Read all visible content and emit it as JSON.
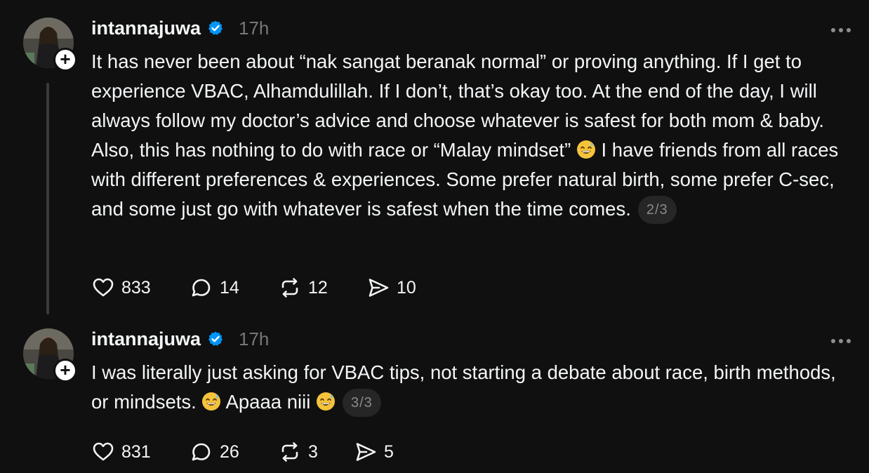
{
  "posts": [
    {
      "username": "intannajuwa",
      "timestamp": "17h",
      "text_before_emoji": "It has never been about “nak sangat beranak normal” or proving anything. If I get to experience VBAC, Alhamdulillah. If I don’t, that’s okay too. At the end of the day, I will always follow my doctor’s advice and choose whatever is safest for both mom & baby. Also, this has nothing to do with race or “Malay mindset” ",
      "text_after_emoji": " I have friends from all races with different preferences & experiences. Some prefer natural birth, some prefer C-sec, and some just go with whatever is safest when the time comes.",
      "emoji": "grinning-sweat-emoji",
      "thread_counter": "2/3",
      "likes": "833",
      "replies": "14",
      "reposts": "12",
      "shares": "10"
    },
    {
      "username": "intannajuwa",
      "timestamp": "17h",
      "text_part1": "I was literally just asking for VBAC tips, not starting a debate about race, birth methods, or mindsets. ",
      "text_part2": " Apaaa niii ",
      "emoji": "grinning-sweat-emoji",
      "thread_counter": "3/3",
      "likes": "831",
      "replies": "26",
      "reposts": "3",
      "shares": "5"
    }
  ],
  "colors": {
    "background": "#101010",
    "text": "#f3f5f7",
    "muted": "#777777",
    "verified": "#0095f6",
    "thread_line": "#3a3a3a"
  },
  "icons": [
    "heart-icon",
    "reply-bubble-icon",
    "repost-icon",
    "share-icon",
    "verified-badge-icon",
    "more-options-icon",
    "follow-plus-icon"
  ]
}
